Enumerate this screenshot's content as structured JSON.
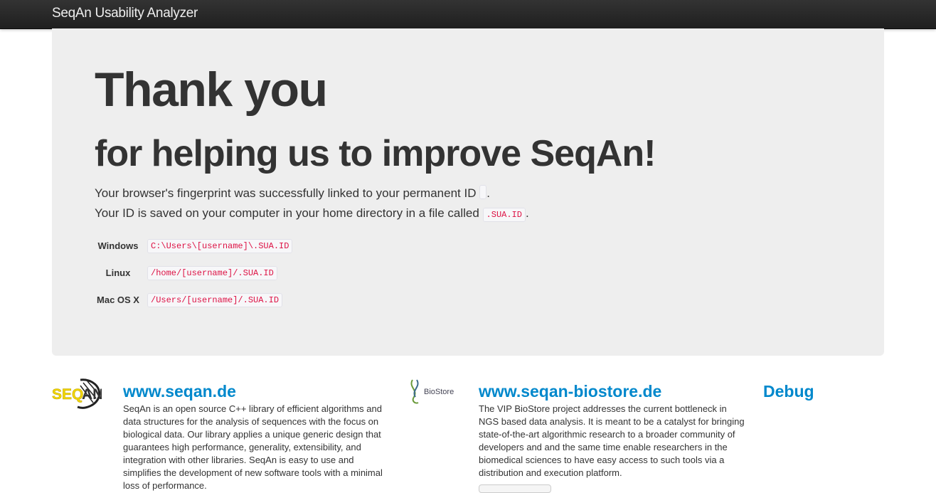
{
  "navbar": {
    "brand": "SeqAn Usability Analyzer"
  },
  "hero": {
    "title": "Thank you",
    "subtitle": "for helping us to improve SeqAn!",
    "line1_text": "Your browser's fingerprint was successfully linked to your permanent ID",
    "line1_id": "",
    "line1_end": ".",
    "line2_text": "Your ID is saved on your computer in your home directory in a file called",
    "line2_file": ".SUA.ID",
    "line2_end": ".",
    "paths": [
      {
        "os": "Windows",
        "path": "C:\\Users\\[username]\\.SUA.ID"
      },
      {
        "os": "Linux",
        "path": "/home/[username]/.SUA.ID"
      },
      {
        "os": "Mac OS X",
        "path": "/Users/[username]/.SUA.ID"
      }
    ]
  },
  "footer": {
    "seqan": {
      "logo_icon": "seqan-logo-icon",
      "title": "www.seqan.de",
      "text": "SeqAn is an open source C++ library of efficient algorithms and data structures for the analysis of sequences with the focus on biological data. Our library applies a unique generic design that guarantees high performance, generality, extensibility, and integration with other libraries. SeqAn is easy to use and simplifies the development of new software tools with a minimal loss of performance."
    },
    "biostore": {
      "logo_icon": "biostore-logo-icon",
      "logo_text": "BioStore",
      "title": "www.seqan-biostore.de",
      "text": "The VIP BioStore project addresses the current bottleneck in NGS based data analysis. It is meant to be a catalyst for bringing state-of-the-art algorithmic research to a broader community of developers and and the same time enable researchers in the biomedical sciences to have easy access to such tools via a distribution and execution platform."
    },
    "debug": {
      "title": "Debug"
    }
  },
  "colors": {
    "navbar": "#222222",
    "hero_bg": "#eeeeee",
    "link": "#0088cc",
    "code": "#dd1144",
    "seqan_yellow": "#f2d600"
  }
}
